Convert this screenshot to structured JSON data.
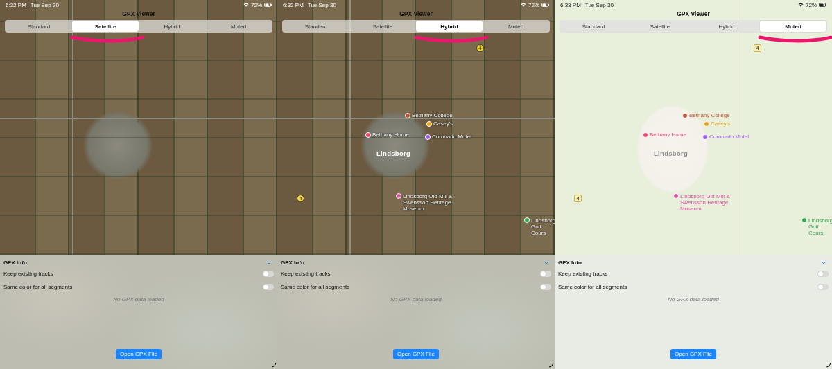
{
  "panels": [
    {
      "status_bar": {
        "time": "6:32 PM",
        "date": "Tue Sep 30",
        "battery": "72%"
      },
      "title": "GPX Viewer",
      "map_types": [
        {
          "label": "Standard",
          "selected": false
        },
        {
          "label": "Satellite",
          "selected": true
        },
        {
          "label": "Hybrid",
          "selected": false
        },
        {
          "label": "Muted",
          "selected": false
        }
      ],
      "map": {
        "kind": "satellite"
      },
      "info": {
        "heading": "GPX Info",
        "toggles": [
          {
            "label": "Keep existing tracks",
            "on": false
          },
          {
            "label": "Same color for all segments",
            "on": false
          }
        ],
        "empty_message": "No GPX data loaded",
        "button": "Open GPX File"
      }
    },
    {
      "status_bar": {
        "time": "6:32 PM",
        "date": "Tue Sep 30",
        "battery": "72%"
      },
      "title": "GPX Viewer",
      "map_types": [
        {
          "label": "Standard",
          "selected": false
        },
        {
          "label": "Satellite",
          "selected": false
        },
        {
          "label": "Hybrid",
          "selected": true
        },
        {
          "label": "Muted",
          "selected": false
        }
      ],
      "map": {
        "kind": "hybrid",
        "places": [
          {
            "kind": "poi",
            "name": "Bethany College",
            "color": "#c0562f"
          },
          {
            "kind": "poi",
            "name": "Casey's",
            "color": "#e8a21a"
          },
          {
            "kind": "poi",
            "name": "Bethany Home",
            "color": "#e8456a"
          },
          {
            "kind": "poi",
            "name": "Coronado Motel",
            "color": "#9b5de5"
          },
          {
            "kind": "city",
            "name": "Lindsborg"
          },
          {
            "kind": "poi",
            "name": "Lindsborg Old Mill & Swensson Heritage Museum",
            "color": "#d94fa0"
          },
          {
            "kind": "poi",
            "name": "Lindsborg Golf Cours",
            "color": "#34a853"
          }
        ],
        "route_shields": [
          "4",
          "4"
        ]
      },
      "info": {
        "heading": "GPX Info",
        "toggles": [
          {
            "label": "Keep existing tracks",
            "on": false
          },
          {
            "label": "Same color for all segments",
            "on": false
          }
        ],
        "empty_message": "No GPX data loaded",
        "button": "Open GPX File"
      }
    },
    {
      "status_bar": {
        "time": "6:33 PM",
        "date": "Tue Sep 30",
        "battery": "72%"
      },
      "title": "GPX Viewer",
      "map_types": [
        {
          "label": "Standard",
          "selected": false
        },
        {
          "label": "Satellite",
          "selected": false
        },
        {
          "label": "Hybrid",
          "selected": false
        },
        {
          "label": "Muted",
          "selected": true
        }
      ],
      "map": {
        "kind": "muted",
        "places": [
          {
            "kind": "poi",
            "name": "Bethany College",
            "color": "#c0562f"
          },
          {
            "kind": "poi",
            "name": "Casey's",
            "color": "#e8a21a"
          },
          {
            "kind": "poi",
            "name": "Bethany Home",
            "color": "#e8456a"
          },
          {
            "kind": "poi",
            "name": "Coronado Motel",
            "color": "#9b5de5"
          },
          {
            "kind": "city",
            "name": "Lindsborg"
          },
          {
            "kind": "poi",
            "name": "Lindsborg Old Mill & Swensson Heritage Museum",
            "color": "#d94fa0"
          },
          {
            "kind": "poi",
            "name": "Lindsborg Golf Cours",
            "color": "#34a853"
          }
        ],
        "route_shields": [
          "4",
          "4"
        ]
      },
      "info": {
        "heading": "GPX Info",
        "toggles": [
          {
            "label": "Keep existing tracks",
            "on": false
          },
          {
            "label": "Same color for all segments",
            "on": false
          }
        ],
        "empty_message": "No GPX data loaded",
        "button": "Open GPX File"
      }
    }
  ]
}
